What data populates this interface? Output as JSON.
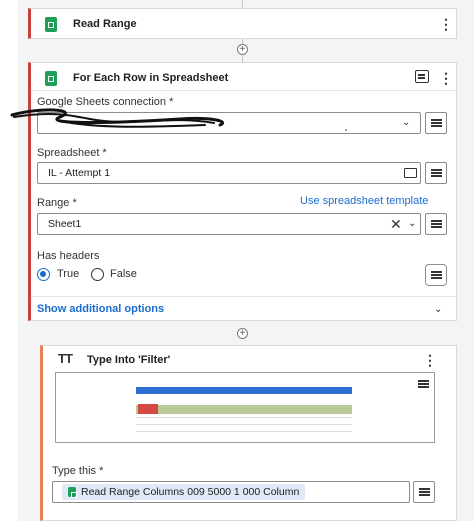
{
  "read_range_card": {
    "title": "Read Range"
  },
  "for_each_card": {
    "title": "For Each Row in Spreadsheet",
    "connection_label": "Google Sheets connection *",
    "spreadsheet_label": "Spreadsheet *",
    "spreadsheet_value": "IL - Attempt 1",
    "range_label": "Range *",
    "range_link": "Use spreadsheet template",
    "range_value": "Sheet1",
    "headers_label": "Has headers",
    "option_true": "True",
    "option_false": "False",
    "selected_header_option": "True",
    "show_more": "Show additional options"
  },
  "type_into_card": {
    "title": "Type Into 'Filter'",
    "type_label": "Type this *",
    "type_value_chip": "Read Range Columns 009 5000 1 000 Column"
  },
  "colors": {
    "accent_red": "#c9413c",
    "accent_orange": "#e8825a",
    "sheets_green": "#1e9e57",
    "link_blue": "#1a6dd0"
  }
}
